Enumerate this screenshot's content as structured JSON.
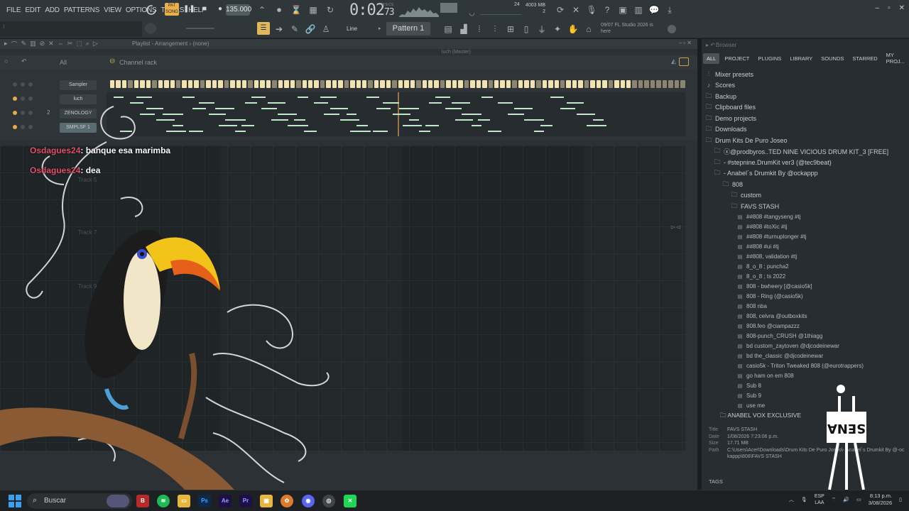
{
  "menu": [
    "FILE",
    "EDIT",
    "ADD",
    "PATTERNS",
    "VIEW",
    "OPTIONS",
    "TOOLS",
    "HELP"
  ],
  "pat_song": "PAT SONG",
  "tempo": "135.000",
  "timer": {
    "main": "0:02",
    "sub": "73",
    "label": "M:S:CS"
  },
  "memory": {
    "mb": "4003 MB",
    "cpu": "24",
    "voices": "2"
  },
  "toolbar": {
    "line_mode": "Line",
    "pattern": "Pattern 1",
    "news_date": "09/07",
    "news_text": "FL Studio 2026 is",
    "news_text2": "here"
  },
  "playlist": {
    "title": "Playlist - Arrangement",
    "arrangement": "(none)",
    "luch_tab": "luch (Master)"
  },
  "channel_rack": {
    "filter": "All",
    "title": "Channel rack",
    "channels": [
      {
        "name": "Sampler",
        "number": ""
      },
      {
        "name": "luch",
        "number": ""
      },
      {
        "name": "ZENOLOGY",
        "number": "2"
      },
      {
        "name": "SMPLSF 1",
        "number": ""
      }
    ]
  },
  "tracks": [
    "Track 5",
    "Track 7",
    "Track 9"
  ],
  "chat": [
    {
      "user": "Osdagues24",
      "message": ": banque esa marimba"
    },
    {
      "user": "Osdagues24",
      "message": ": dea"
    }
  ],
  "browser": {
    "title": "Browser",
    "tabs": [
      "ALL",
      "PROJECT",
      "PLUGINS",
      "LIBRARY",
      "SOUNDS",
      "STARRED",
      "MY PROJ..."
    ],
    "active_tab": "ALL",
    "tree": [
      {
        "label": "Mixer presets",
        "icon": "mixer",
        "level": 0
      },
      {
        "label": "Scores",
        "icon": "note",
        "level": 0
      },
      {
        "label": "Backup",
        "icon": "folder",
        "level": 0
      },
      {
        "label": "Clipboard files",
        "icon": "folder",
        "level": 0
      },
      {
        "label": "Demo projects",
        "icon": "folder",
        "level": 0
      },
      {
        "label": "Downloads",
        "icon": "folder",
        "level": 0
      },
      {
        "label": "Drum Kits De Puro Joseo",
        "icon": "folder",
        "level": 0
      },
      {
        "label": "ⓧ@prodbyros..TED NINE VICIOUS DRUM KIT_3 [FREE]",
        "icon": "folder",
        "level": 1
      },
      {
        "label": "- #stepnine.DrumKit ver3 (@tec9beat)",
        "icon": "folder",
        "level": 1
      },
      {
        "label": "- Anabel´s Drumkit By @ockappp",
        "icon": "folder",
        "level": 1
      },
      {
        "label": "808",
        "icon": "folder",
        "level": 2
      },
      {
        "label": "custom",
        "icon": "folder",
        "level": 3
      },
      {
        "label": "FAVS STASH",
        "icon": "folder",
        "level": 3
      }
    ],
    "files": [
      "##808 #tangyseng #tj",
      "##808 #toXic #tj",
      "##808 #turnuplonger #tj",
      "##808 #ui #tj",
      "##808, validation #tj",
      "8_o_8 ; puncha2",
      "8_o_8 ; ts 2022",
      "808 - bwheery [@casio5k]",
      "808 - Ring (@casio5k)",
      "808 nba",
      "808, celvra @outboxkits",
      "808.feo @ciampazzz",
      "808-punch_CRUSH @1thiagg",
      "bd custom_zaytoven @djcodeinewar",
      "bd the_classic @djcodeinewar",
      "casio5k - Triton Tweaked 808 (@eurotrappers)",
      "go ham on em 808",
      "Sub 8",
      "Sub 9",
      "use me"
    ],
    "footer_folder": "ANABEL VOX EXCLUSIVE",
    "info": {
      "title_label": "Title",
      "title": "FAVS STASH",
      "date_label": "Date",
      "date": "1/08/2026 7:23:06 p.m.",
      "size_label": "Size",
      "size": "17.71 MB",
      "path_label": "Path",
      "path": "C:\\Users\\Acer\\Downloads\\Drum Kits De Puro Joseo\\- Anabel´s Drumkit By @-ockappp\\808\\FAVS STASH"
    },
    "tags_label": "TAGS"
  },
  "taskbar": {
    "search": "Buscar",
    "lang": "ESP",
    "lang2": "LAA",
    "time": "8:13 p.m.",
    "date": "3/08/2026"
  },
  "colors": {
    "accent": "#e2b95a",
    "chat_user": "#e0506a",
    "note": "#bfe6c4"
  }
}
